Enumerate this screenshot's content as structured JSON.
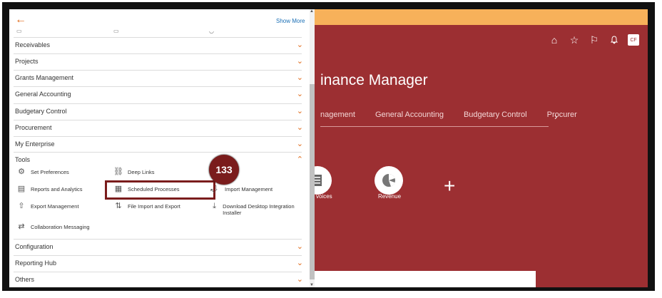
{
  "panel": {
    "show_more": "Show More",
    "sections": [
      {
        "label": "Receivables"
      },
      {
        "label": "Projects"
      },
      {
        "label": "Grants Management"
      },
      {
        "label": "General Accounting"
      },
      {
        "label": "Budgetary Control"
      },
      {
        "label": "Procurement"
      },
      {
        "label": "My Enterprise"
      },
      {
        "label": "Tools"
      },
      {
        "label": "Configuration"
      },
      {
        "label": "Reporting Hub"
      },
      {
        "label": "Others"
      }
    ],
    "tools": {
      "set_preferences": "Set Preferences",
      "deep_links": "Deep Links",
      "reports_analytics": "Reports and Analytics",
      "scheduled_processes": "Scheduled Processes",
      "import_management": "Import Management",
      "export_management": "Export Management",
      "file_import_export": "File Import and Export",
      "download_desktop": "Download Desktop Integration Installer",
      "collaboration_messaging": "Collaboration Messaging"
    }
  },
  "callout": {
    "step": "133"
  },
  "app": {
    "title": "inance Manager",
    "tabs": [
      "nagement",
      "General Accounting",
      "Budgetary Control",
      "Procurer"
    ],
    "tiles": [
      {
        "label": "voices"
      },
      {
        "label": "Revenue"
      }
    ],
    "avatar": "CF"
  },
  "colors": {
    "accent": "#e06b1a",
    "app_bg": "#9c2f32",
    "callout": "#7a1c1c",
    "banner": "#f7b15a"
  }
}
